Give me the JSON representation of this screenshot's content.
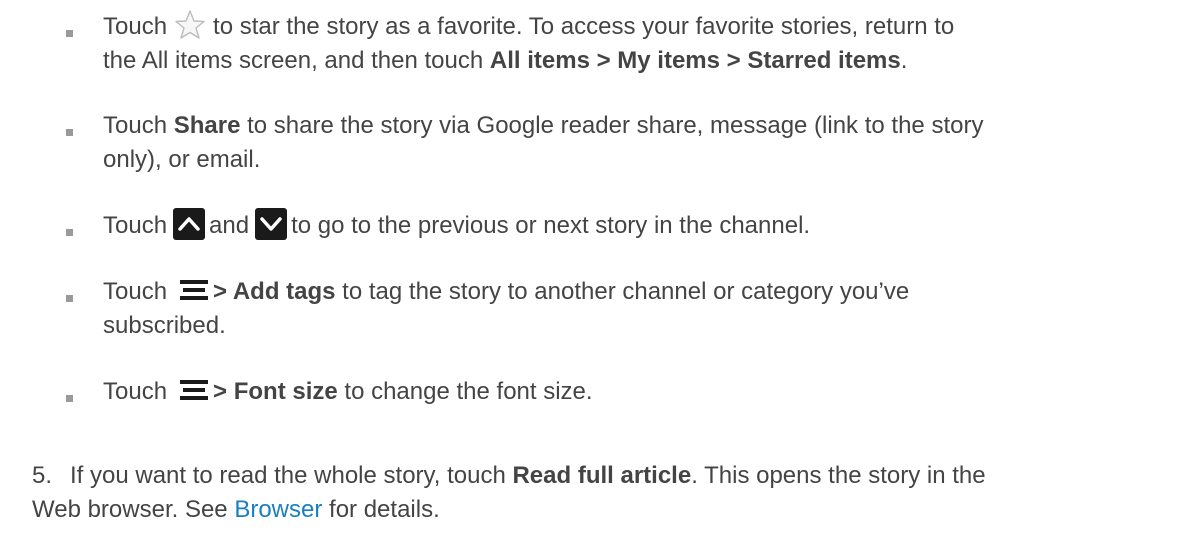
{
  "bullets": [
    {
      "touch": "Touch",
      "star_icon": "star-outline-icon",
      "line1_rest": "to star the story as a favorite. To access your favorite stories, return to",
      "line2_pre": "the All items screen, and then touch ",
      "line2_bold": "All items > My items > Starred items",
      "line2_end": "."
    },
    {
      "touch": "Touch ",
      "bold": "Share",
      "line1_rest": " to share the story via Google reader share, message (link to the story",
      "line2": "only), or email."
    },
    {
      "touch": "Touch",
      "up_icon": "chevron-up-icon",
      "and": "and",
      "down_icon": "chevron-down-icon",
      "rest": "to go to the previous or next story in the channel."
    },
    {
      "touch": "Touch",
      "menu_icon": "menu-icon",
      "bold": "> Add tags",
      "line1_rest": " to tag the story to another channel or category you’ve",
      "line2": "subscribed."
    },
    {
      "touch": "Touch",
      "menu_icon": "menu-icon",
      "bold": "> Font size",
      "rest": " to change the font size."
    }
  ],
  "step5": {
    "number": "5.",
    "pre": "If you want to read the whole story, touch ",
    "bold": "Read full article",
    "post": ". This opens the story in the",
    "line2_pre": "Web browser. See ",
    "link": "Browser",
    "line2_post": " for details."
  },
  "colors": {
    "text": "#444444",
    "link": "#1a7fc1",
    "bullet": "#9a9a9a"
  }
}
